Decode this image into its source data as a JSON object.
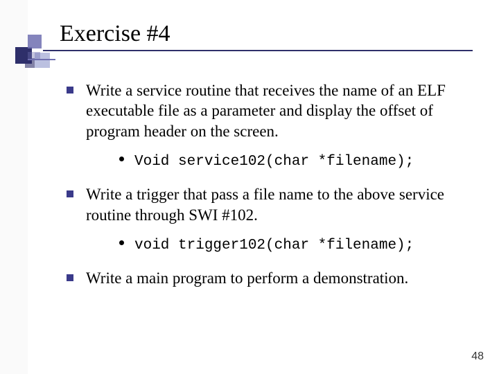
{
  "title": "Exercise #4",
  "bullets": [
    {
      "text": "Write a service routine that receives the name of an ELF executable file as a parameter and display the offset of program header on the screen.",
      "sub": {
        "code": "Void service102(char *filename);"
      }
    },
    {
      "text": "Write a trigger that pass a file name to the above service routine through SWI #102.",
      "sub": {
        "code": "void trigger102(char *filename);"
      }
    },
    {
      "text": "Write a main program to perform a demonstration."
    }
  ],
  "page_number": "48"
}
